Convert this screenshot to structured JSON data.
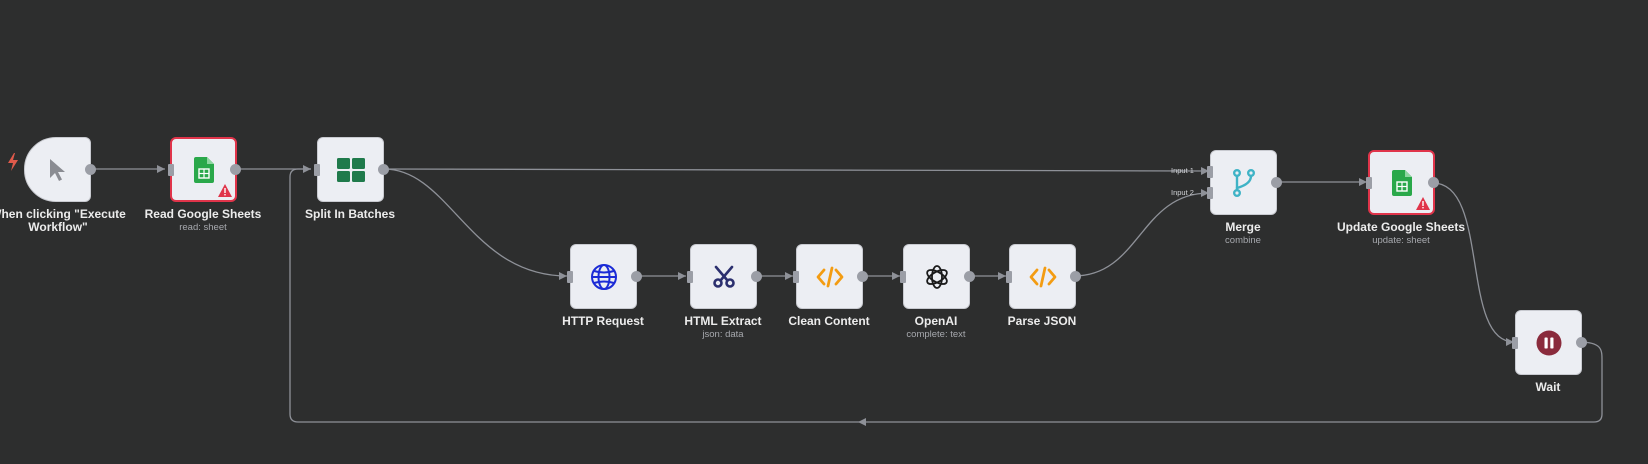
{
  "nodes": {
    "trigger": {
      "label_line1": "When clicking \"Execute",
      "label_line2": "Workflow\"",
      "icon": "cursor-icon"
    },
    "read_sheets": {
      "label": "Read Google Sheets",
      "sub": "read: sheet",
      "icon": "google-sheets-icon",
      "status": "warning"
    },
    "split": {
      "label": "Split In Batches",
      "icon": "grid-icon"
    },
    "http": {
      "label": "HTTP Request",
      "icon": "globe-icon"
    },
    "html_extract": {
      "label": "HTML Extract",
      "sub": "json: data",
      "icon": "scissors-icon"
    },
    "clean": {
      "label": "Clean Content",
      "icon": "code-icon"
    },
    "openai": {
      "label": "OpenAI",
      "sub": "complete: text",
      "icon": "openai-icon"
    },
    "parse": {
      "label": "Parse JSON",
      "icon": "code-icon"
    },
    "merge": {
      "label": "Merge",
      "sub": "combine",
      "icon": "branch-merge-icon",
      "input1": "Input 1",
      "input2": "Input 2"
    },
    "update_sheets": {
      "label": "Update Google Sheets",
      "sub": "update: sheet",
      "icon": "google-sheets-icon",
      "status": "warning"
    },
    "wait": {
      "label": "Wait",
      "icon": "pause-icon"
    }
  },
  "colors": {
    "canvas": "#2d2e2e",
    "node": "#eceef3",
    "error_border": "#e0344a",
    "edge": "#9b9ea6",
    "sheets_green": "#2aa84a",
    "split_green": "#1f7a4b",
    "globe_blue": "#1b2bd6",
    "code_orange": "#f39c12",
    "merge_teal": "#3fb3c6",
    "wait_maroon": "#8a2b3c",
    "scissors_navy": "#2b2f6e"
  }
}
